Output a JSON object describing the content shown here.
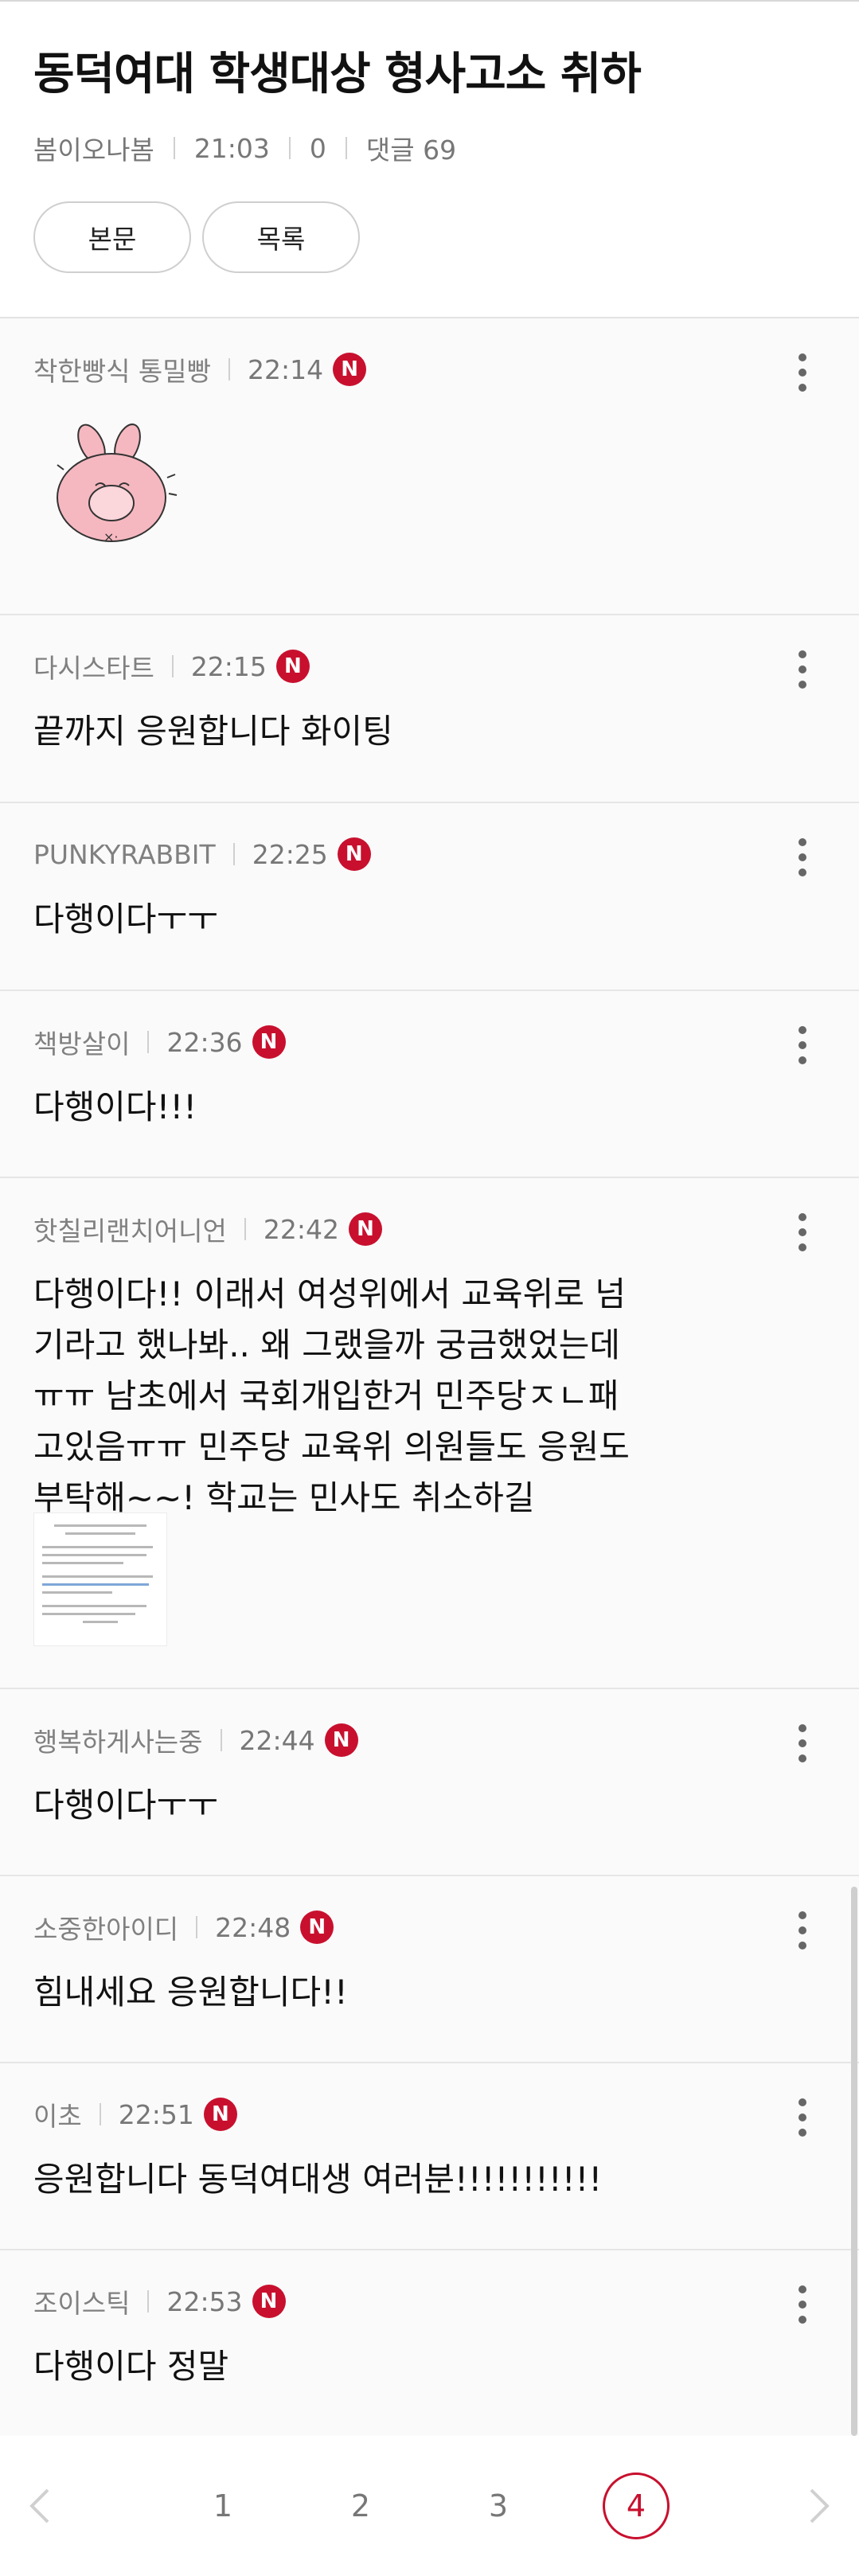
{
  "post": {
    "title": "동덕여대 학생대상 형사고소 취하",
    "author": "봄이오나봄",
    "time": "21:03",
    "views": "0",
    "comments_label": "댓글 69",
    "btn_body": "본문",
    "btn_list": "목록"
  },
  "comments": [
    {
      "author": "착한빵식 통밀빵",
      "time": "22:14",
      "badge": "N",
      "text": ""
    },
    {
      "author": "다시스타트",
      "time": "22:15",
      "badge": "N",
      "text": "끝까지 응원합니다 화이팅"
    },
    {
      "author": "PUNKYRABBIT",
      "time": "22:25",
      "badge": "N",
      "text": "다행이다ㅜㅜ"
    },
    {
      "author": "책방살이",
      "time": "22:36",
      "badge": "N",
      "text": "다행이다!!!"
    },
    {
      "author": "핫칠리랜치어니언",
      "time": "22:42",
      "badge": "N",
      "text": "다행이다!! 이래서 여성위에서 교육위로 넘\n기라고 했나봐.. 왜 그랬을까 궁금했었는데\nㅠㅠ 남초에서 국회개입한거 민주당ㅈㄴ패\n고있음ㅠㅠ 민주당 교육위 의원들도 응원도\n부탁해~~! 학교는 민사도 취소하길"
    },
    {
      "author": "행복하게사는중",
      "time": "22:44",
      "badge": "N",
      "text": "다행이다ㅜㅜ"
    },
    {
      "author": "소중한아이디",
      "time": "22:48",
      "badge": "N",
      "text": "힘내세요 응원합니다!!"
    },
    {
      "author": "이초",
      "time": "22:51",
      "badge": "N",
      "text": "응원합니다 동덕여대생 여러분!!!!!!!!!!!"
    },
    {
      "author": "조이스틱",
      "time": "22:53",
      "badge": "N",
      "text": "다행이다 정말"
    }
  ],
  "pagination": {
    "pages": [
      "1",
      "2",
      "3",
      "4"
    ],
    "current": "4",
    "prev_icon": "chevron-left-icon",
    "next_icon": "chevron-right-icon"
  },
  "colors": {
    "badge": "#c8102e",
    "active_page": "#c8102e"
  }
}
